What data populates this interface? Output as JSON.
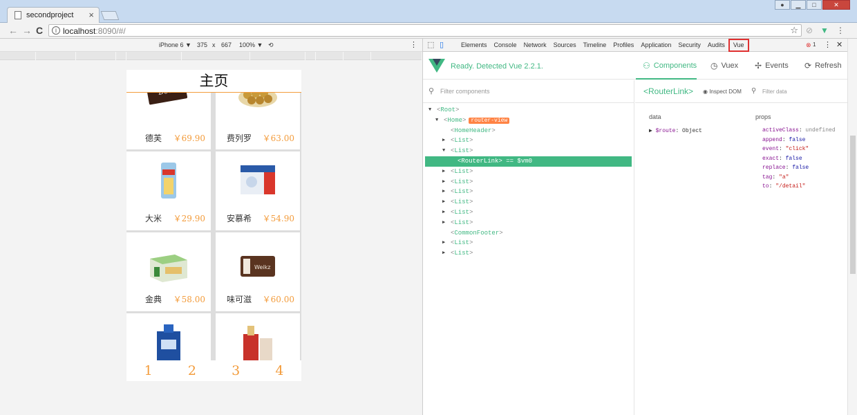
{
  "browser": {
    "tab_title": "secondproject",
    "tab_close": "×",
    "url_host": "localhost",
    "url_rest": ":8090/#/",
    "nav_back": "←",
    "nav_forward": "→",
    "nav_reload": "C",
    "star": "☆"
  },
  "device_toolbar": {
    "device": "iPhone 6 ▼",
    "width": "375",
    "x": "x",
    "height": "667",
    "zoom": "100% ▼",
    "rotate": "⟲"
  },
  "app": {
    "header_title": "主页",
    "products": [
      {
        "name": "德芙",
        "price": "￥69.90",
        "icon": "chocolate-icon"
      },
      {
        "name": "费列罗",
        "price": "￥63.00",
        "icon": "ferrero-icon"
      },
      {
        "name": "大米",
        "price": "￥29.90",
        "icon": "rice-bag-icon"
      },
      {
        "name": "安慕希",
        "price": "￥54.90",
        "icon": "yogurt-box-icon"
      },
      {
        "name": "金典",
        "price": "￥58.00",
        "icon": "milk-box-icon"
      },
      {
        "name": "味可滋",
        "price": "￥60.00",
        "icon": "milk-drink-icon"
      },
      {
        "name": "",
        "price": "",
        "icon": "liquor-blue-icon"
      },
      {
        "name": "",
        "price": "",
        "icon": "liquor-red-icon"
      }
    ],
    "footer": [
      "1",
      "2",
      "3",
      "4"
    ]
  },
  "devtools": {
    "tabs": [
      "Elements",
      "Console",
      "Network",
      "Sources",
      "Timeline",
      "Profiles",
      "Application",
      "Security",
      "Audits",
      "Vue"
    ],
    "error_count": "1",
    "ready_text": "Ready. Detected Vue 2.2.1.",
    "vue_tabs": [
      "Components",
      "Vuex",
      "Events",
      "Refresh"
    ],
    "filter_components_placeholder": "Filter components",
    "tree": [
      {
        "label": "Root",
        "depth": 0,
        "arrow": "▼"
      },
      {
        "label": "Home",
        "depth": 1,
        "arrow": "▼",
        "badge": "router-view"
      },
      {
        "label": "HomeHeader",
        "depth": 2,
        "arrow": ""
      },
      {
        "label": "List",
        "depth": 2,
        "arrow": "▶"
      },
      {
        "label": "List",
        "depth": 2,
        "arrow": "▼"
      },
      {
        "label": "RouterLink",
        "depth": 3,
        "arrow": "",
        "selected": true,
        "suffix": " == $vm0"
      },
      {
        "label": "List",
        "depth": 2,
        "arrow": "▶"
      },
      {
        "label": "List",
        "depth": 2,
        "arrow": "▶"
      },
      {
        "label": "List",
        "depth": 2,
        "arrow": "▶"
      },
      {
        "label": "List",
        "depth": 2,
        "arrow": "▶"
      },
      {
        "label": "List",
        "depth": 2,
        "arrow": "▶"
      },
      {
        "label": "List",
        "depth": 2,
        "arrow": "▶"
      },
      {
        "label": "CommonFooter",
        "depth": 2,
        "arrow": ""
      },
      {
        "label": "List",
        "depth": 2,
        "arrow": "▶"
      },
      {
        "label": "List",
        "depth": 2,
        "arrow": "▶"
      }
    ],
    "selected_component": "<RouterLink>",
    "inspect_dom": "Inspect DOM",
    "filter_data_placeholder": "Filter data",
    "data_label": "data",
    "props_label": "props",
    "data_rows": [
      {
        "key": "$route",
        "value": "Object"
      }
    ],
    "props": [
      {
        "key": "activeClass",
        "value": "undefined",
        "kind": "undef"
      },
      {
        "key": "append",
        "value": "false",
        "kind": "val"
      },
      {
        "key": "event",
        "value": "\"click\"",
        "kind": "str"
      },
      {
        "key": "exact",
        "value": "false",
        "kind": "val"
      },
      {
        "key": "replace",
        "value": "false",
        "kind": "val"
      },
      {
        "key": "tag",
        "value": "\"a\"",
        "kind": "str"
      },
      {
        "key": "to",
        "value": "\"/detail\"",
        "kind": "str"
      }
    ]
  },
  "colors": {
    "vue_green": "#41b883",
    "price_orange": "#f39c3c",
    "highlight_red": "#e03030"
  }
}
